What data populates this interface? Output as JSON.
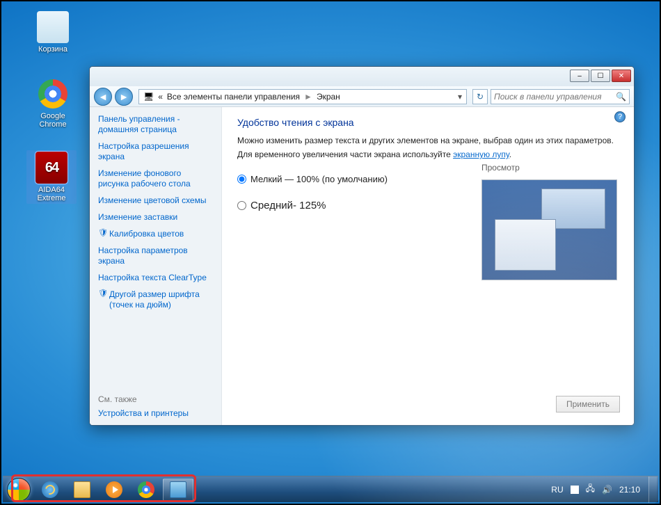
{
  "desktop": {
    "icons": {
      "recycle": "Корзина",
      "chrome": "Google Chrome",
      "aida": "AIDA64 Extreme",
      "aida_badge": "64"
    }
  },
  "window": {
    "controls": {
      "min": "–",
      "max": "☐",
      "close": "✕"
    },
    "breadcrumb": {
      "prefix": "«",
      "root": "Все элементы панели управления",
      "arrow": "►",
      "leaf": "Экран",
      "dd": "▾"
    },
    "refresh": "↻",
    "search_placeholder": "Поиск в панели управления",
    "help": "?",
    "sidebar": {
      "items": [
        "Панель управления - домашняя страница",
        "Настройка разрешения экрана",
        "Изменение фонового рисунка рабочего стола",
        "Изменение цветовой схемы",
        "Изменение заставки",
        "Калибровка цветов",
        "Настройка параметров экрана",
        "Настройка текста ClearType",
        "Другой размер шрифта (точек на дюйм)"
      ],
      "seealso_hdr": "См. также",
      "seealso_link": "Устройства и принтеры"
    },
    "content": {
      "heading": "Удобство чтения с экрана",
      "para1": "Можно изменить размер текста и других элементов на экране, выбрав один из этих параметров.",
      "para2_a": "Для временного увеличения части экрана используйте ",
      "para2_link": "экранную лупу",
      "para2_b": ".",
      "opt1": "Мелкий — 100% (по умолчанию)",
      "opt2": "Средний- 125%",
      "preview_lbl": "Просмотр",
      "apply": "Применить"
    }
  },
  "taskbar": {
    "lang": "RU",
    "time": "21:10"
  }
}
